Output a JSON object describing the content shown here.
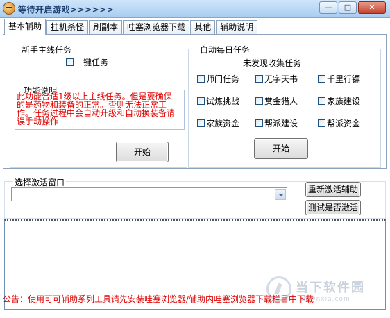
{
  "window": {
    "title": "等待开启游戏>>>>>>",
    "minimize": "—",
    "maximize": "□",
    "close": "✕"
  },
  "tabs": [
    {
      "label": "基本辅助",
      "active": true
    },
    {
      "label": "挂机杀怪",
      "active": false
    },
    {
      "label": "刷副本",
      "active": false
    },
    {
      "label": "哇塞浏览器下载",
      "active": false
    },
    {
      "label": "其他",
      "active": false
    },
    {
      "label": "辅助说明",
      "active": false
    }
  ],
  "newbie": {
    "legend": "新手主线任务",
    "one_click": "一键任务",
    "func_legend": "功能说明",
    "description": [
      "此功能合适1级以上主线任务。但是要确保",
      "的是药物和装备的正常。否则无法正常工",
      "作。任务过程中会自动升级和自动换装备请",
      "误手动操作"
    ],
    "start": "开始"
  },
  "daily": {
    "legend": "自动每日任务",
    "subtitle": "未发现收集任务",
    "tasks": [
      "师门任务",
      "无字天书",
      "千里行镖",
      "试炼挑战",
      "赏金猎人",
      "家族建设",
      "家族资金",
      "帮派建设",
      "帮派资金"
    ],
    "start": "开始"
  },
  "activate": {
    "legend": "选择激活窗口",
    "reactivate": "重新激活辅助",
    "test": "测试是否激活"
  },
  "notice": "公告：使用可可辅助系列工具请先安装哇塞浏览器/辅助内哇塞浏览器下载栏目中下载",
  "watermark": {
    "name": "当下软件园",
    "site": "downxia.com"
  },
  "colors": {
    "notice_red": "#e00000",
    "title_blue": "#1b3d6e"
  }
}
